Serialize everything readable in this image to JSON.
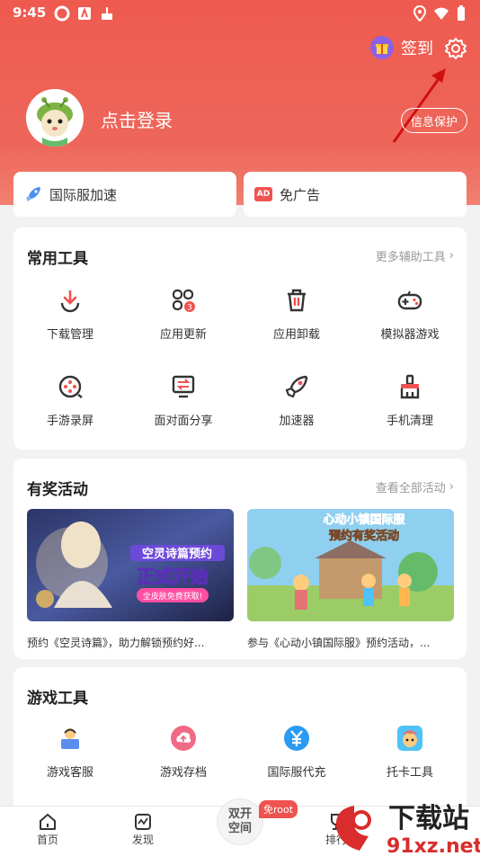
{
  "status": {
    "time": "9:45"
  },
  "header": {
    "signin_label": "签到",
    "login_label": "点击登录",
    "privacy_label": "信息保护"
  },
  "quick": [
    {
      "label": "国际服加速"
    },
    {
      "label": "免广告",
      "badge": "AD"
    }
  ],
  "tools_card": {
    "title": "常用工具",
    "more": "更多辅助工具",
    "items": [
      {
        "label": "下载管理",
        "icon": "download-icon"
      },
      {
        "label": "应用更新",
        "icon": "app-update-icon",
        "badge": "3"
      },
      {
        "label": "应用卸载",
        "icon": "trash-icon"
      },
      {
        "label": "模拟器游戏",
        "icon": "gamepad-icon"
      },
      {
        "label": "手游录屏",
        "icon": "record-icon"
      },
      {
        "label": "面对面分享",
        "icon": "share-screen-icon"
      },
      {
        "label": "加速器",
        "icon": "rocket-icon"
      },
      {
        "label": "手机清理",
        "icon": "broom-icon"
      }
    ]
  },
  "activities_card": {
    "title": "有奖活动",
    "more": "查看全部活动",
    "banners": [
      {
        "caption": "预约《空灵诗篇》，助力解锁预约好...",
        "art_title": "空灵诗篇预约",
        "art_sub": "正式开始",
        "art_tag": "全皮肤免费获取!"
      },
      {
        "caption": "参与《心动小镇国际服》预约活动，...",
        "art_title": "心动小镇国际服",
        "art_sub": "预约有奖活动"
      }
    ]
  },
  "game_tools_card": {
    "title": "游戏工具",
    "items": [
      {
        "label": "游戏客服",
        "icon": "customer-service-icon"
      },
      {
        "label": "游戏存档",
        "icon": "cloud-save-icon"
      },
      {
        "label": "国际服代充",
        "icon": "yuan-icon"
      },
      {
        "label": "托卡工具",
        "icon": "toca-icon"
      }
    ]
  },
  "bottom_nav": {
    "items": [
      {
        "label": "首页"
      },
      {
        "label": "发现"
      },
      {
        "label": "排行"
      }
    ],
    "center_line1": "双开",
    "center_line2": "空间",
    "root_badge": "免root"
  },
  "watermark": {
    "text1": "下载站",
    "text2": "91xz.net"
  }
}
